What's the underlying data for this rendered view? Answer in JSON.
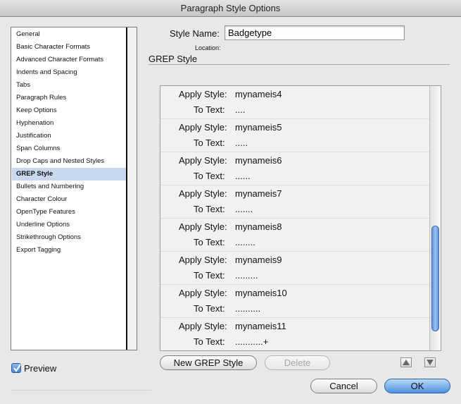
{
  "window": {
    "title": "Paragraph Style Options"
  },
  "sidebar": {
    "items": [
      {
        "label": "General"
      },
      {
        "label": "Basic Character Formats"
      },
      {
        "label": "Advanced Character Formats"
      },
      {
        "label": "Indents and Spacing"
      },
      {
        "label": "Tabs"
      },
      {
        "label": "Paragraph Rules"
      },
      {
        "label": "Keep Options"
      },
      {
        "label": "Hyphenation"
      },
      {
        "label": "Justification"
      },
      {
        "label": "Span Columns"
      },
      {
        "label": "Drop Caps and Nested Styles"
      },
      {
        "label": "GREP Style",
        "selected": true
      },
      {
        "label": "Bullets and Numbering"
      },
      {
        "label": "Character Colour"
      },
      {
        "label": "OpenType Features"
      },
      {
        "label": "Underline Options"
      },
      {
        "label": "Strikethrough Options"
      },
      {
        "label": "Export Tagging"
      }
    ]
  },
  "header": {
    "style_name_label": "Style Name:",
    "style_name_value": "Badgetype",
    "location_label": "Location:",
    "section_title": "GREP Style"
  },
  "grep": {
    "apply_label": "Apply Style:",
    "to_text_label": "To Text:",
    "rows": [
      {
        "style": "mynameis4",
        "text": "...."
      },
      {
        "style": "mynameis5",
        "text": "....."
      },
      {
        "style": "mynameis6",
        "text": "......"
      },
      {
        "style": "mynameis7",
        "text": "......."
      },
      {
        "style": "mynameis8",
        "text": "........"
      },
      {
        "style": "mynameis9",
        "text": "........."
      },
      {
        "style": "mynameis10",
        "text": ".........."
      },
      {
        "style": "mynameis11",
        "text": "...........+"
      }
    ],
    "new_button": "New GREP Style",
    "delete_button": "Delete",
    "move_up_icon": "triangle-up-icon",
    "move_down_icon": "triangle-down-icon"
  },
  "footer": {
    "preview_label": "Preview",
    "preview_checked": true,
    "cancel_button": "Cancel",
    "ok_button": "OK"
  },
  "colors": {
    "selection": "#c8d8ee",
    "ok_button": "#4d92e0",
    "scroll_thumb": "#5d92d8"
  }
}
